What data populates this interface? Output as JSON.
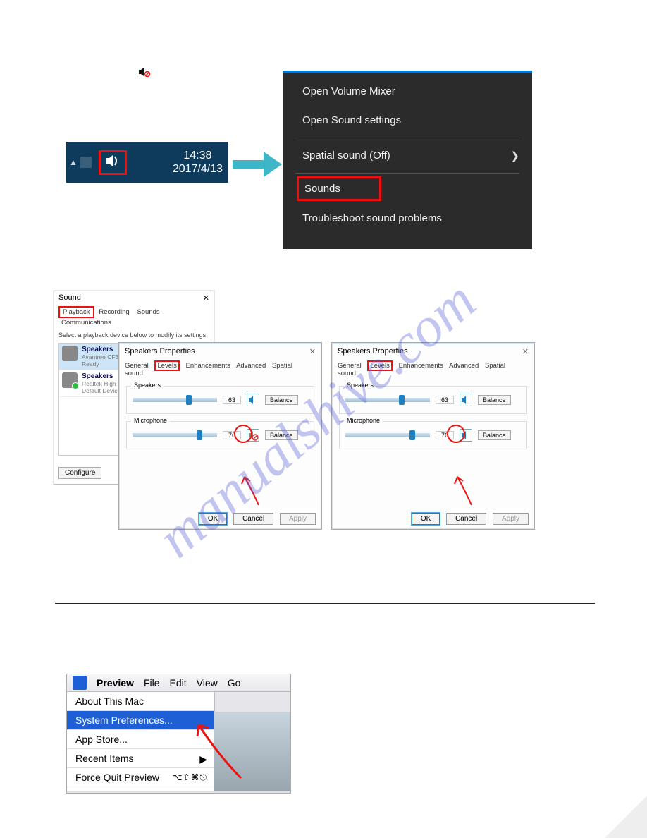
{
  "muted_icon_alt": "speaker-muted",
  "taskbar": {
    "time": "14:38",
    "date": "2017/4/13",
    "speaker_icon": "🔊",
    "up_triangle": "▲"
  },
  "context_menu": {
    "items": [
      "Open Volume Mixer",
      "Open Sound settings",
      "Spatial sound (Off)",
      "Sounds",
      "Troubleshoot sound problems"
    ],
    "chevron": "❯"
  },
  "sound_panel": {
    "title": "Sound",
    "close": "✕",
    "tabs": [
      "Playback",
      "Recording",
      "Sounds",
      "Communications"
    ],
    "hint": "Select a playback device below to modify its settings:",
    "devices": [
      {
        "name": "Speakers",
        "sub1": "Avantree CF3001",
        "sub2": "Ready"
      },
      {
        "name": "Speakers",
        "sub1": "Realtek High De",
        "sub2": "Default Device"
      }
    ],
    "configure": "Configure"
  },
  "speakers_properties": {
    "title": "Speakers Properties",
    "close": "✕",
    "tabs": [
      "General",
      "Levels",
      "Enhancements",
      "Advanced",
      "Spatial sound"
    ],
    "groups": {
      "speakers": {
        "label": "Speakers",
        "value": "63",
        "balance": "Balance"
      },
      "microphone": {
        "label": "Microphone",
        "value": "76",
        "balance": "Balance"
      }
    },
    "buttons": {
      "ok": "OK",
      "cancel": "Cancel",
      "apply": "Apply"
    }
  },
  "mac": {
    "menubar": {
      "apple": "",
      "app": "Preview",
      "items": [
        "File",
        "Edit",
        "View",
        "Go"
      ]
    },
    "dropdown": [
      {
        "label": "About This Mac"
      },
      {
        "label": "System Preferences..."
      },
      {
        "label": "App Store..."
      },
      {
        "label": "Recent Items",
        "submenu": "▶"
      },
      {
        "label": "Force Quit Preview",
        "shortcut": "⌥⇧⌘⎋"
      }
    ]
  }
}
